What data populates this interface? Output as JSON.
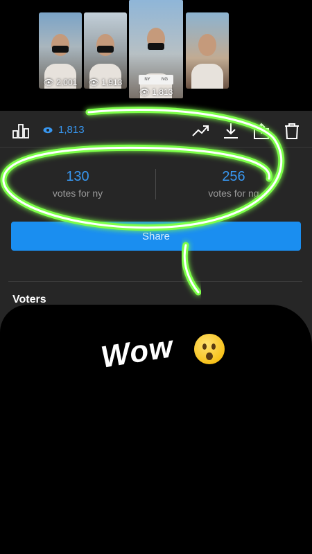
{
  "thumbnails": [
    {
      "views": "2,001"
    },
    {
      "views": "1,913"
    },
    {
      "views": "1,813",
      "active": true,
      "poll_options": [
        "NY",
        "NG"
      ]
    },
    {
      "views": ""
    }
  ],
  "toolbar": {
    "views": "1,813",
    "icons": [
      "insights-bar-icon",
      "eye-icon",
      "trending-icon",
      "download-icon",
      "share-icon",
      "trash-icon"
    ]
  },
  "poll_results": {
    "left": {
      "count": "130",
      "label": "votes for ny"
    },
    "right": {
      "count": "256",
      "label": "votes for ng"
    }
  },
  "share_button": {
    "label": "Share"
  },
  "voters": {
    "heading": "Voters"
  },
  "sticker": {
    "text": "Wow"
  },
  "colors": {
    "accent": "#3897f0",
    "panel": "#262626",
    "highlight": "#7dff4a"
  }
}
